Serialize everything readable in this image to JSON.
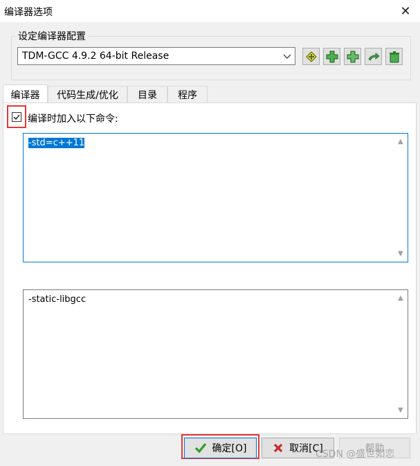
{
  "window": {
    "title": "编译器选项",
    "close_label": "✕"
  },
  "compiler_set": {
    "group_label": "设定编译器配置",
    "selected": "TDM-GCC 4.9.2 64-bit Release",
    "toolbar_icons": [
      "wand-icon",
      "add-icon",
      "add-copy-icon",
      "rename-icon",
      "delete-icon"
    ]
  },
  "tabs": [
    "编译器",
    "代码生成/优化",
    "目录",
    "程序"
  ],
  "compiler_tab": {
    "checkbox_label": "编译时加入以下命令:",
    "checkbox_checked": true,
    "compile_commands": "-std=c++11",
    "linker_commands": "-static-libgcc"
  },
  "buttons": {
    "ok": "确定[O]",
    "cancel": "取消[C]",
    "help": "帮助"
  },
  "watermark": "CSDN @盛世如恋",
  "colors": {
    "accent": "#0078d7",
    "highlight_outline": "#e53935",
    "ok_check": "#2e9b2e",
    "cancel_x": "#c62828"
  }
}
